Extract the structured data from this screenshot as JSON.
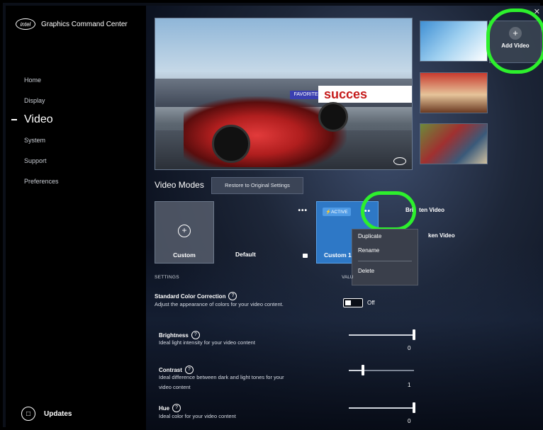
{
  "app": {
    "brand_logo": "intel",
    "title": "Graphics Command Center"
  },
  "sidebar": {
    "items": [
      {
        "label": "Home",
        "active": false
      },
      {
        "label": "Display",
        "active": false
      },
      {
        "label": "Video",
        "active": true
      },
      {
        "label": "System",
        "active": false
      },
      {
        "label": "Support",
        "active": false
      },
      {
        "label": "Preferences",
        "active": false
      }
    ],
    "updates_label": "Updates"
  },
  "preview": {
    "banner_text": "succes",
    "banner_small": "FAVORITE"
  },
  "gallery": {
    "add_video_label": "Add Video"
  },
  "video_modes": {
    "title": "Video Modes",
    "restore_label": "Restore to Original Settings",
    "cards": [
      {
        "label": "Custom"
      },
      {
        "label": "Default"
      },
      {
        "label": "Custom 1",
        "badge": "ACTIVE"
      }
    ],
    "side_options": [
      "Bri",
      "ten Video",
      "ken Video"
    ],
    "context_menu": [
      "Duplicate",
      "Rename",
      "Delete"
    ]
  },
  "settings": {
    "header": "SETTINGS",
    "values_header": "VALU",
    "items": [
      {
        "title": "Standard Color Correction",
        "desc": "Adjust the appearance of colors for your video content.",
        "control": "toggle",
        "value": "Off"
      },
      {
        "title": "Brightness",
        "desc": "Ideal light intensity for your video content",
        "control": "slider",
        "value": "0",
        "position": 1.0
      },
      {
        "title": "Contrast",
        "desc1": "Ideal difference between dark and light tones for your",
        "desc2": "video content",
        "control": "slider",
        "value": "1",
        "position": 0.22
      },
      {
        "title": "Hue",
        "desc": "Ideal color for your video content",
        "control": "slider",
        "value": "0",
        "position": 1.0
      }
    ]
  },
  "colors": {
    "accent": "#2e78c6",
    "highlight_ring": "#2df02d",
    "sidebar_bg": "#000000"
  }
}
